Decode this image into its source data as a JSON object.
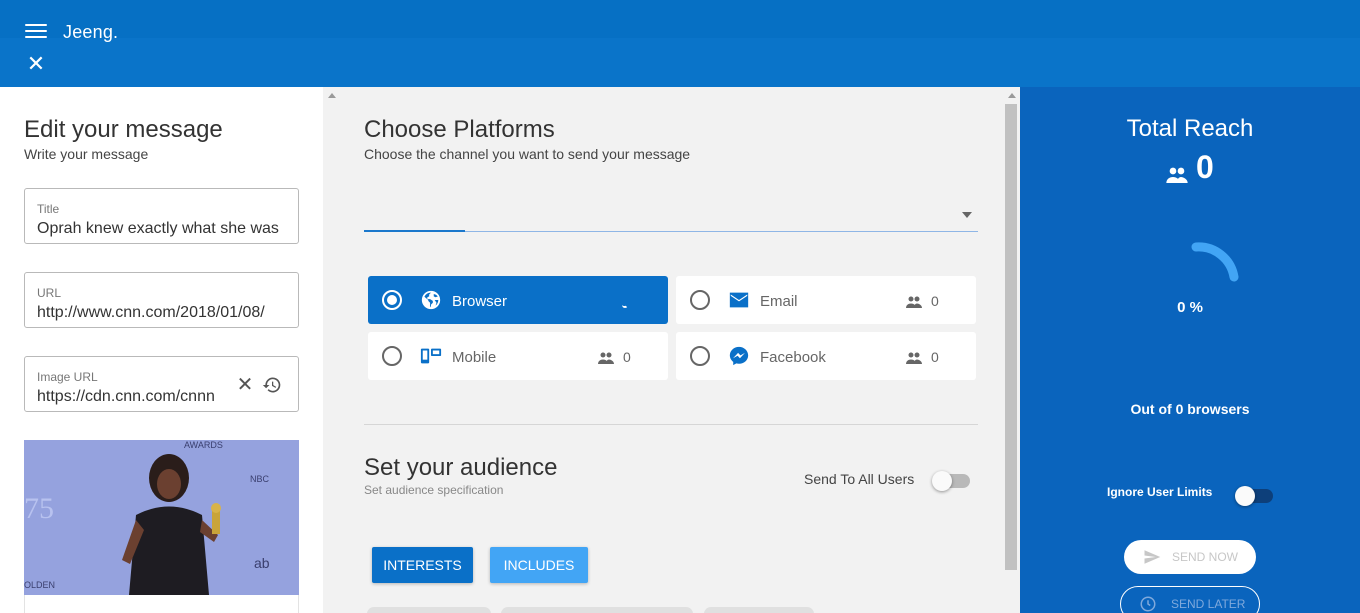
{
  "header": {
    "brand": "Jeeng.",
    "menu_icon": "menu-icon",
    "close_icon": "close-icon"
  },
  "editor": {
    "title": "Edit your message",
    "subtitle": "Write your message",
    "fields": {
      "title": {
        "label": "Title",
        "value": "Oprah knew exactly what she was"
      },
      "url": {
        "label": "URL",
        "value": "http://www.cnn.com/2018/01/08/"
      },
      "image_url": {
        "label": "Image URL",
        "value": "https://cdn.cnn.com/cnnn"
      }
    },
    "preview_image_icon": "image-preview"
  },
  "platforms": {
    "title": "Choose Platforms",
    "subtitle": "Choose the channel you want to send your message",
    "options": [
      {
        "label": "Browser",
        "count": "",
        "selected": true,
        "icon": "globe-icon"
      },
      {
        "label": "Email",
        "count": "0",
        "selected": false,
        "icon": "email-icon"
      },
      {
        "label": "Mobile",
        "count": "0",
        "selected": false,
        "icon": "mobile-icon"
      },
      {
        "label": "Facebook",
        "count": "0",
        "selected": false,
        "icon": "messenger-icon"
      }
    ]
  },
  "audience": {
    "title": "Set your audience",
    "subtitle": "Set audience specification",
    "send_all_label": "Send To All Users",
    "send_all_on": false,
    "interests_label": "INTERESTS",
    "includes_label": "INCLUDES"
  },
  "reach": {
    "title": "Total Reach",
    "count": "0",
    "percent_label": "0 %",
    "out_of": "Out of 0 browsers",
    "ignore_limits_label": "Ignore User Limits",
    "ignore_limits_on": false,
    "send_now_label": "SEND NOW",
    "send_later_label": "SEND LATER"
  },
  "colors": {
    "primary": "#0a70c8",
    "header": "#0a74c9",
    "right_panel": "#0a64bd",
    "accent_light": "#42a5f5"
  }
}
